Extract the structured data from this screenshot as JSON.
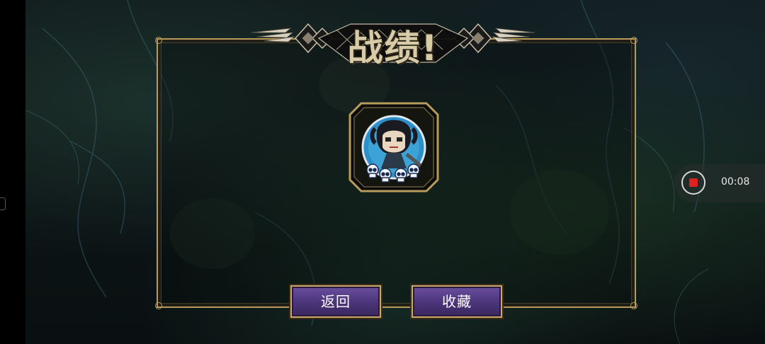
{
  "title": "战绩!",
  "buttons": {
    "back": "返回",
    "collect": "收藏"
  },
  "recorder": {
    "time": "00:08"
  },
  "badge": {
    "skull_count": 4
  },
  "colors": {
    "gold": "#b89a5a",
    "button_purple": "#4b3478",
    "record_red": "#dd2222"
  }
}
